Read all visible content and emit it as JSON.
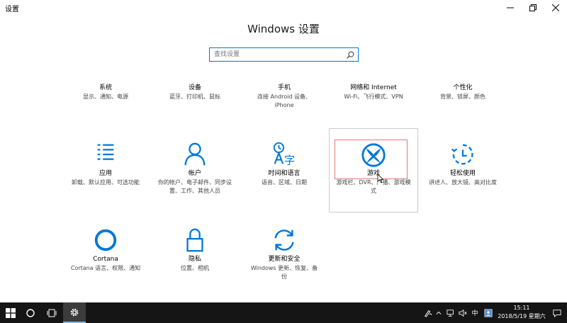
{
  "window": {
    "title": "设置"
  },
  "header": {
    "title": "Windows 设置"
  },
  "search": {
    "placeholder": "查找设置"
  },
  "tiles": [
    {
      "name": "系统",
      "desc": "显示、通知、电源",
      "icon": "laptop-icon"
    },
    {
      "name": "设备",
      "desc": "蓝牙、打印机、鼠标",
      "icon": "keyboard-speaker-icon"
    },
    {
      "name": "手机",
      "desc": "连接 Android 设备、iPhone",
      "icon": "phone-icon"
    },
    {
      "name": "网络和 Internet",
      "desc": "Wi-Fi、飞行模式、VPN",
      "icon": "globe-icon"
    },
    {
      "name": "个性化",
      "desc": "背景、锁屏、颜色",
      "icon": "paintbrush-icon"
    },
    {
      "name": "应用",
      "desc": "卸载、默认应用、可选功能",
      "icon": "apps-list-icon"
    },
    {
      "name": "帐户",
      "desc": "你的帐户、电子邮件、同步设置、工作、其他人员",
      "icon": "person-icon"
    },
    {
      "name": "时间和语言",
      "desc": "语音、区域、日期",
      "icon": "time-language-icon"
    },
    {
      "name": "游戏",
      "desc": "游戏栏、DVR、广播、游戏模式",
      "icon": "xbox-icon"
    },
    {
      "name": "轻松使用",
      "desc": "讲述人、放大镜、高对比度",
      "icon": "ease-of-access-icon"
    },
    {
      "name": "Cortana",
      "desc": "Cortana 语言、权限、通知",
      "icon": "cortana-icon"
    },
    {
      "name": "隐私",
      "desc": "位置、相机",
      "icon": "lock-icon"
    },
    {
      "name": "更新和安全",
      "desc": "Windows 更新、恢复、备份",
      "icon": "update-icon"
    }
  ],
  "taskbar": {
    "ime": "中",
    "time": "15:11",
    "date": "2018/5/19 星期六"
  },
  "colors": {
    "accent": "#0078d7",
    "taskbar": "#151515"
  }
}
